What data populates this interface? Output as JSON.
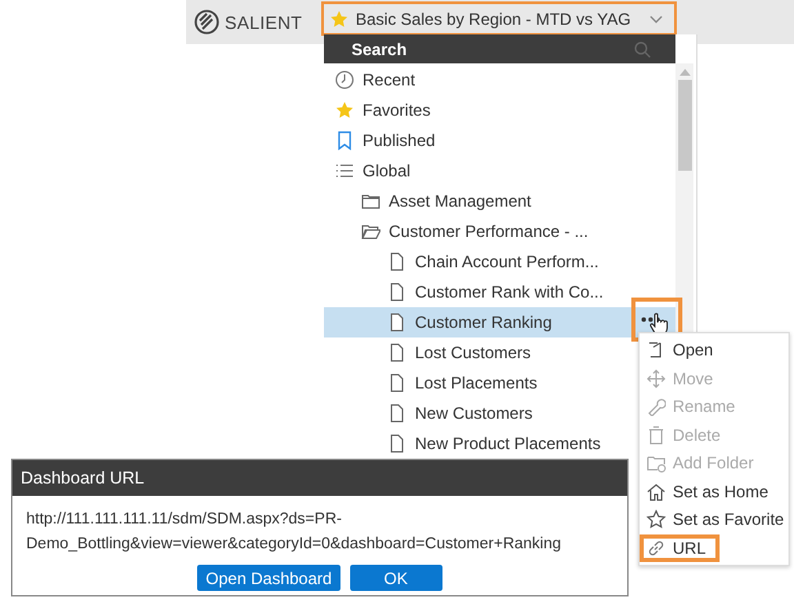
{
  "header": {
    "logo": "SALIENT",
    "dashboard_selector": {
      "label": "Basic Sales by Region - MTD vs YAG",
      "favorite": true,
      "callout": true
    }
  },
  "browser": {
    "search": {
      "placeholder": "Search"
    },
    "items": [
      {
        "kind": "recent",
        "label": "Recent",
        "selected": false
      },
      {
        "kind": "favorites",
        "label": "Favorites",
        "selected": false
      },
      {
        "kind": "published",
        "label": "Published",
        "selected": false
      },
      {
        "kind": "category",
        "label": "Global",
        "selected": false,
        "children": [
          {
            "kind": "folder",
            "label": "Asset Management",
            "expanded": false,
            "selected": false
          },
          {
            "kind": "folder",
            "label": "Customer Performance - ...",
            "expanded": true,
            "selected": false,
            "children": [
              {
                "kind": "document",
                "label": "Chain Account Perform...",
                "selected": false
              },
              {
                "kind": "document",
                "label": "Customer Rank with Co...",
                "selected": false
              },
              {
                "kind": "document",
                "label": "Customer Ranking",
                "selected": true
              },
              {
                "kind": "document",
                "label": "Lost Customers",
                "selected": false
              },
              {
                "kind": "document",
                "label": "Lost Placements",
                "selected": false
              },
              {
                "kind": "document",
                "label": "New Customers",
                "selected": false
              },
              {
                "kind": "document",
                "label": "New Product Placements",
                "selected": false
              }
            ]
          }
        ]
      }
    ]
  },
  "context_menu": {
    "trigger_callout": true,
    "items": [
      {
        "kind": "open",
        "label": "Open",
        "disabled": false,
        "callout": false
      },
      {
        "kind": "move",
        "label": "Move",
        "disabled": true,
        "callout": false
      },
      {
        "kind": "rename",
        "label": "Rename",
        "disabled": true,
        "callout": false
      },
      {
        "kind": "delete",
        "label": "Delete",
        "disabled": true,
        "callout": false
      },
      {
        "kind": "add-folder",
        "label": "Add Folder",
        "disabled": true,
        "callout": false
      },
      {
        "kind": "home",
        "label": "Set as Home",
        "disabled": false,
        "callout": false
      },
      {
        "kind": "favorite",
        "label": "Set as Favorite",
        "disabled": false,
        "callout": false
      },
      {
        "kind": "url",
        "label": "URL",
        "disabled": false,
        "callout": true
      }
    ]
  },
  "dialog": {
    "title": "Dashboard URL",
    "text": "http://111.111.111.11/sdm/SDM.aspx?ds=PR-Demo_Bottling&view=viewer&categoryId=0&dashboard=Customer+Ranking",
    "buttons": [
      {
        "label": "Open Dashboard"
      },
      {
        "label": "OK"
      }
    ]
  }
}
